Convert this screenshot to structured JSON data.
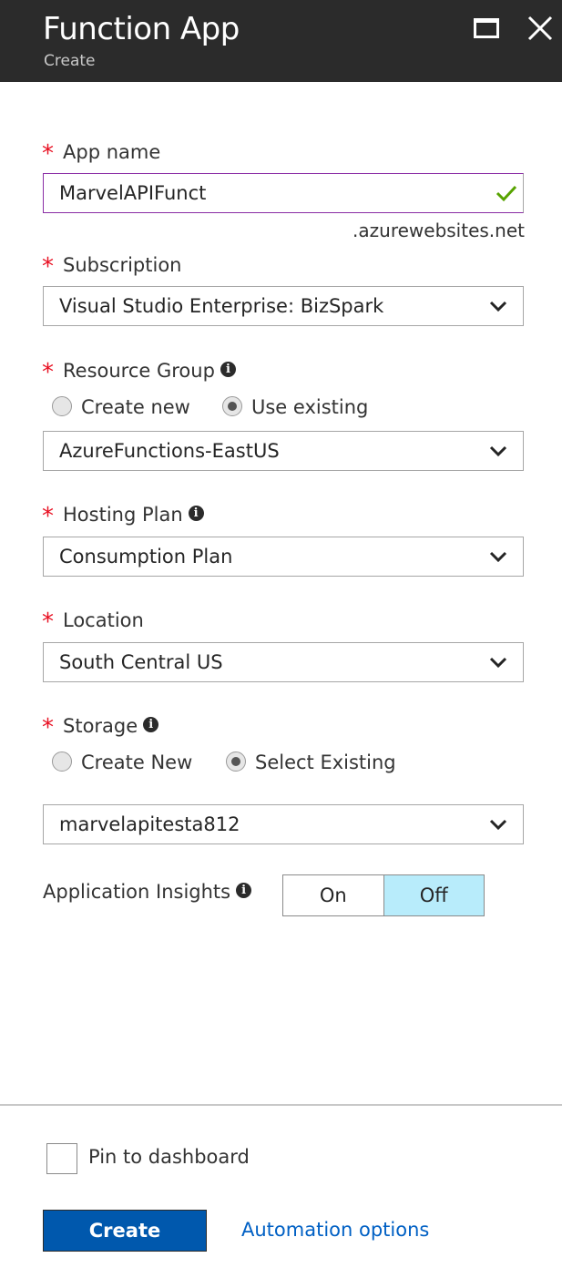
{
  "header": {
    "title": "Function App",
    "subtitle": "Create",
    "maximize_icon": "maximize-icon",
    "close_icon": "close-icon"
  },
  "app_name": {
    "label": "App name",
    "value": "MarvelAPIFunct",
    "suffix": ".azurewebsites.net",
    "valid_icon": "checkmark-icon",
    "valid_color": "#57a300"
  },
  "subscription": {
    "label": "Subscription",
    "value": "Visual Studio Enterprise: BizSpark"
  },
  "resource_group": {
    "label": "Resource Group",
    "option_new": "Create new",
    "option_existing": "Use existing",
    "selected": "Use existing",
    "value": "AzureFunctions-EastUS"
  },
  "hosting_plan": {
    "label": "Hosting Plan",
    "value": "Consumption Plan"
  },
  "location": {
    "label": "Location",
    "value": "South Central US"
  },
  "storage": {
    "label": "Storage",
    "option_new": "Create New",
    "option_existing": "Select Existing",
    "selected": "Select Existing",
    "value": "marvelapitesta812"
  },
  "app_insights": {
    "label": "Application Insights",
    "on_label": "On",
    "off_label": "Off",
    "selected": "Off",
    "selected_color": "#b8ecfb"
  },
  "footer": {
    "pin_label": "Pin to dashboard",
    "pin_checked": false,
    "create_label": "Create",
    "automation_label": "Automation options",
    "accent": "#0058ad"
  },
  "required_marker": "*"
}
